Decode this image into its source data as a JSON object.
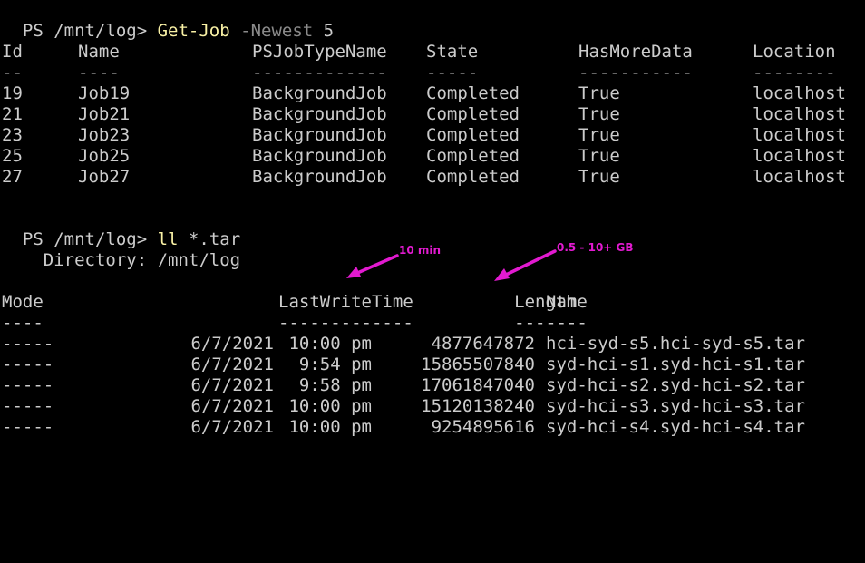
{
  "colors": {
    "background": "#000000",
    "text": "#cccccc",
    "command": "#f9f1a5",
    "parameter": "#8a8a8a",
    "annotation": "#e21ad0"
  },
  "cmd1": {
    "prompt": "PS /mnt/log> ",
    "command": "Get-Job",
    "param": "-Newest",
    "arg": "5"
  },
  "jobs": {
    "headers": [
      "Id",
      "Name",
      "PSJobTypeName",
      "State",
      "HasMoreData",
      "Location"
    ],
    "underlines": [
      "--",
      "----",
      "-------------",
      "-----",
      "-----------",
      "--------"
    ],
    "rows": [
      [
        "19",
        "Job19",
        "BackgroundJob",
        "Completed",
        "True",
        "localhost"
      ],
      [
        "21",
        "Job21",
        "BackgroundJob",
        "Completed",
        "True",
        "localhost"
      ],
      [
        "23",
        "Job23",
        "BackgroundJob",
        "Completed",
        "True",
        "localhost"
      ],
      [
        "25",
        "Job25",
        "BackgroundJob",
        "Completed",
        "True",
        "localhost"
      ],
      [
        "27",
        "Job27",
        "BackgroundJob",
        "Completed",
        "True",
        "localhost"
      ]
    ]
  },
  "cmd2": {
    "prompt": "PS /mnt/log> ",
    "command": "ll",
    "arg": "*.tar"
  },
  "dir": {
    "label": "    Directory: /mnt/log"
  },
  "files": {
    "headers": [
      "Mode",
      "LastWriteTime",
      "Length",
      "Name"
    ],
    "underlines": [
      "----",
      "-------------",
      "------",
      "----"
    ],
    "rows": [
      [
        "-----",
        "6/7/2021",
        "10:00 pm",
        "4877647872",
        "hci-syd-s5.hci-syd-s5.tar"
      ],
      [
        "-----",
        "6/7/2021",
        "9:54 pm",
        "15865507840",
        "syd-hci-s1.syd-hci-s1.tar"
      ],
      [
        "-----",
        "6/7/2021",
        "9:58 pm",
        "17061847040",
        "syd-hci-s2.syd-hci-s2.tar"
      ],
      [
        "-----",
        "6/7/2021",
        "10:00 pm",
        "15120138240",
        "syd-hci-s3.syd-hci-s3.tar"
      ],
      [
        "-----",
        "6/7/2021",
        "10:00 pm",
        "9254895616",
        "syd-hci-s4.syd-hci-s4.tar"
      ]
    ]
  },
  "annotations": {
    "time_note": "10 min",
    "size_note": "0.5 - 10+ GB"
  }
}
